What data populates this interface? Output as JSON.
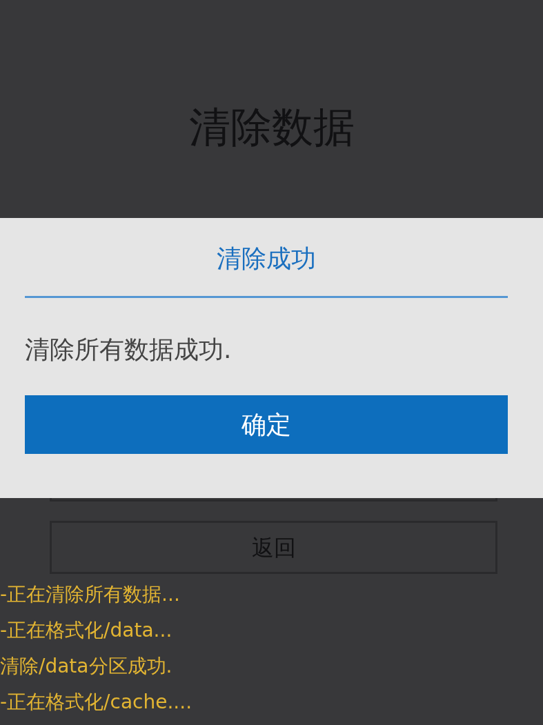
{
  "screen": {
    "title": "清除数据"
  },
  "buttons": [
    {
      "label": "返回"
    }
  ],
  "log": [
    "-正在清除所有数据...",
    "-正在格式化/data...",
    "清除/data分区成功.",
    "-正在格式化/cache...."
  ],
  "dialog": {
    "title": "清除成功",
    "message": "清除所有数据成功.",
    "button": "确定"
  }
}
